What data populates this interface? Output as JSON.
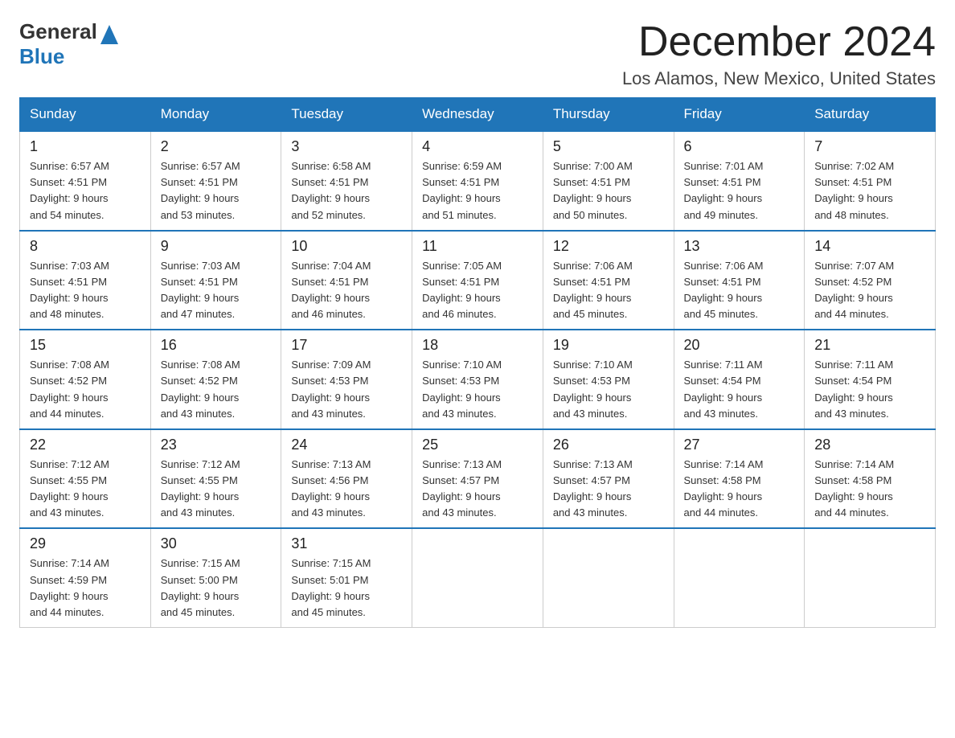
{
  "header": {
    "logo_general": "General",
    "logo_blue": "Blue",
    "month_title": "December 2024",
    "location": "Los Alamos, New Mexico, United States"
  },
  "weekdays": [
    "Sunday",
    "Monday",
    "Tuesday",
    "Wednesday",
    "Thursday",
    "Friday",
    "Saturday"
  ],
  "weeks": [
    [
      {
        "day": "1",
        "sunrise": "Sunrise: 6:57 AM",
        "sunset": "Sunset: 4:51 PM",
        "daylight": "Daylight: 9 hours",
        "daylight2": "and 54 minutes."
      },
      {
        "day": "2",
        "sunrise": "Sunrise: 6:57 AM",
        "sunset": "Sunset: 4:51 PM",
        "daylight": "Daylight: 9 hours",
        "daylight2": "and 53 minutes."
      },
      {
        "day": "3",
        "sunrise": "Sunrise: 6:58 AM",
        "sunset": "Sunset: 4:51 PM",
        "daylight": "Daylight: 9 hours",
        "daylight2": "and 52 minutes."
      },
      {
        "day": "4",
        "sunrise": "Sunrise: 6:59 AM",
        "sunset": "Sunset: 4:51 PM",
        "daylight": "Daylight: 9 hours",
        "daylight2": "and 51 minutes."
      },
      {
        "day": "5",
        "sunrise": "Sunrise: 7:00 AM",
        "sunset": "Sunset: 4:51 PM",
        "daylight": "Daylight: 9 hours",
        "daylight2": "and 50 minutes."
      },
      {
        "day": "6",
        "sunrise": "Sunrise: 7:01 AM",
        "sunset": "Sunset: 4:51 PM",
        "daylight": "Daylight: 9 hours",
        "daylight2": "and 49 minutes."
      },
      {
        "day": "7",
        "sunrise": "Sunrise: 7:02 AM",
        "sunset": "Sunset: 4:51 PM",
        "daylight": "Daylight: 9 hours",
        "daylight2": "and 48 minutes."
      }
    ],
    [
      {
        "day": "8",
        "sunrise": "Sunrise: 7:03 AM",
        "sunset": "Sunset: 4:51 PM",
        "daylight": "Daylight: 9 hours",
        "daylight2": "and 48 minutes."
      },
      {
        "day": "9",
        "sunrise": "Sunrise: 7:03 AM",
        "sunset": "Sunset: 4:51 PM",
        "daylight": "Daylight: 9 hours",
        "daylight2": "and 47 minutes."
      },
      {
        "day": "10",
        "sunrise": "Sunrise: 7:04 AM",
        "sunset": "Sunset: 4:51 PM",
        "daylight": "Daylight: 9 hours",
        "daylight2": "and 46 minutes."
      },
      {
        "day": "11",
        "sunrise": "Sunrise: 7:05 AM",
        "sunset": "Sunset: 4:51 PM",
        "daylight": "Daylight: 9 hours",
        "daylight2": "and 46 minutes."
      },
      {
        "day": "12",
        "sunrise": "Sunrise: 7:06 AM",
        "sunset": "Sunset: 4:51 PM",
        "daylight": "Daylight: 9 hours",
        "daylight2": "and 45 minutes."
      },
      {
        "day": "13",
        "sunrise": "Sunrise: 7:06 AM",
        "sunset": "Sunset: 4:51 PM",
        "daylight": "Daylight: 9 hours",
        "daylight2": "and 45 minutes."
      },
      {
        "day": "14",
        "sunrise": "Sunrise: 7:07 AM",
        "sunset": "Sunset: 4:52 PM",
        "daylight": "Daylight: 9 hours",
        "daylight2": "and 44 minutes."
      }
    ],
    [
      {
        "day": "15",
        "sunrise": "Sunrise: 7:08 AM",
        "sunset": "Sunset: 4:52 PM",
        "daylight": "Daylight: 9 hours",
        "daylight2": "and 44 minutes."
      },
      {
        "day": "16",
        "sunrise": "Sunrise: 7:08 AM",
        "sunset": "Sunset: 4:52 PM",
        "daylight": "Daylight: 9 hours",
        "daylight2": "and 43 minutes."
      },
      {
        "day": "17",
        "sunrise": "Sunrise: 7:09 AM",
        "sunset": "Sunset: 4:53 PM",
        "daylight": "Daylight: 9 hours",
        "daylight2": "and 43 minutes."
      },
      {
        "day": "18",
        "sunrise": "Sunrise: 7:10 AM",
        "sunset": "Sunset: 4:53 PM",
        "daylight": "Daylight: 9 hours",
        "daylight2": "and 43 minutes."
      },
      {
        "day": "19",
        "sunrise": "Sunrise: 7:10 AM",
        "sunset": "Sunset: 4:53 PM",
        "daylight": "Daylight: 9 hours",
        "daylight2": "and 43 minutes."
      },
      {
        "day": "20",
        "sunrise": "Sunrise: 7:11 AM",
        "sunset": "Sunset: 4:54 PM",
        "daylight": "Daylight: 9 hours",
        "daylight2": "and 43 minutes."
      },
      {
        "day": "21",
        "sunrise": "Sunrise: 7:11 AM",
        "sunset": "Sunset: 4:54 PM",
        "daylight": "Daylight: 9 hours",
        "daylight2": "and 43 minutes."
      }
    ],
    [
      {
        "day": "22",
        "sunrise": "Sunrise: 7:12 AM",
        "sunset": "Sunset: 4:55 PM",
        "daylight": "Daylight: 9 hours",
        "daylight2": "and 43 minutes."
      },
      {
        "day": "23",
        "sunrise": "Sunrise: 7:12 AM",
        "sunset": "Sunset: 4:55 PM",
        "daylight": "Daylight: 9 hours",
        "daylight2": "and 43 minutes."
      },
      {
        "day": "24",
        "sunrise": "Sunrise: 7:13 AM",
        "sunset": "Sunset: 4:56 PM",
        "daylight": "Daylight: 9 hours",
        "daylight2": "and 43 minutes."
      },
      {
        "day": "25",
        "sunrise": "Sunrise: 7:13 AM",
        "sunset": "Sunset: 4:57 PM",
        "daylight": "Daylight: 9 hours",
        "daylight2": "and 43 minutes."
      },
      {
        "day": "26",
        "sunrise": "Sunrise: 7:13 AM",
        "sunset": "Sunset: 4:57 PM",
        "daylight": "Daylight: 9 hours",
        "daylight2": "and 43 minutes."
      },
      {
        "day": "27",
        "sunrise": "Sunrise: 7:14 AM",
        "sunset": "Sunset: 4:58 PM",
        "daylight": "Daylight: 9 hours",
        "daylight2": "and 44 minutes."
      },
      {
        "day": "28",
        "sunrise": "Sunrise: 7:14 AM",
        "sunset": "Sunset: 4:58 PM",
        "daylight": "Daylight: 9 hours",
        "daylight2": "and 44 minutes."
      }
    ],
    [
      {
        "day": "29",
        "sunrise": "Sunrise: 7:14 AM",
        "sunset": "Sunset: 4:59 PM",
        "daylight": "Daylight: 9 hours",
        "daylight2": "and 44 minutes."
      },
      {
        "day": "30",
        "sunrise": "Sunrise: 7:15 AM",
        "sunset": "Sunset: 5:00 PM",
        "daylight": "Daylight: 9 hours",
        "daylight2": "and 45 minutes."
      },
      {
        "day": "31",
        "sunrise": "Sunrise: 7:15 AM",
        "sunset": "Sunset: 5:01 PM",
        "daylight": "Daylight: 9 hours",
        "daylight2": "and 45 minutes."
      },
      null,
      null,
      null,
      null
    ]
  ]
}
